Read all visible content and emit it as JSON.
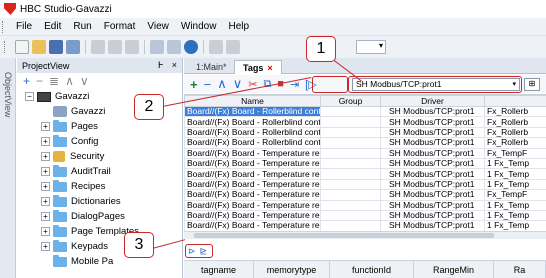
{
  "window": {
    "title": "HBC Studio-Gavazzi"
  },
  "menu": [
    "File",
    "Edit",
    "Run",
    "Format",
    "View",
    "Window",
    "Help"
  ],
  "side_tab": "ObjectView",
  "project_panel": {
    "title": "ProjectView",
    "pin": "Ͱ",
    "close": "×",
    "tree": [
      {
        "label": "Gavazzi",
        "icon": "pc",
        "exp": "−"
      },
      {
        "label": "Gavazzi",
        "icon": "db",
        "exp": ""
      },
      {
        "label": "Pages",
        "icon": "folder",
        "exp": "+"
      },
      {
        "label": "Config",
        "icon": "folder",
        "exp": "+"
      },
      {
        "label": "Security",
        "icon": "lock",
        "exp": "+"
      },
      {
        "label": "AuditTrail",
        "icon": "folder",
        "exp": "+"
      },
      {
        "label": "Recipes",
        "icon": "folder",
        "exp": "+"
      },
      {
        "label": "Dictionaries",
        "icon": "folder",
        "exp": "+"
      },
      {
        "label": "DialogPages",
        "icon": "folder",
        "exp": "+"
      },
      {
        "label": "Page Templates",
        "icon": "folder",
        "exp": "+"
      },
      {
        "label": "Keypads",
        "icon": "folder",
        "exp": "+"
      },
      {
        "label": "Mobile Pa",
        "icon": "folder",
        "exp": ""
      }
    ]
  },
  "tabs": {
    "main": "1:Main*",
    "tags": "Tags",
    "tags_close": "×"
  },
  "driver_selector": {
    "value": "SH Modbus/TCP:prot1",
    "arrow": "▾"
  },
  "grid": {
    "headers": [
      "Name",
      "Group",
      "Driver",
      ""
    ],
    "rows": [
      [
        "Board//(Fx) Board - Rollerblind control.",
        "",
        "SH Modbus/TCP:prot1",
        "Fx_Rollerb"
      ],
      [
        "Board//(Fx) Board - Rollerblind control.",
        "",
        "SH Modbus/TCP:prot1",
        "Fx_Rollerb"
      ],
      [
        "Board//(Fx) Board - Rollerblind control.",
        "",
        "SH Modbus/TCP:prot1",
        "Fx_Rollerb"
      ],
      [
        "Board//(Fx) Board - Rollerblind control.",
        "",
        "SH Modbus/TCP:prot1",
        "Fx_Rollerb"
      ],
      [
        "Board//(Fx) Board - Temperature regul",
        "",
        "SH Modbus/TCP:prot1",
        "Fx_TempF"
      ],
      [
        "Board//(Fx) Board - Temperature regul",
        "",
        "SH Modbus/TCP:prot1",
        "1 Fx_Temp"
      ],
      [
        "Board//(Fx) Board - Temperature regul",
        "",
        "SH Modbus/TCP:prot1",
        "1 Fx_Temp"
      ],
      [
        "Board//(Fx) Board - Temperature regul",
        "",
        "SH Modbus/TCP:prot1",
        "1 Fx_Temp"
      ],
      [
        "Board//(Fx) Board - Temperature regul",
        "",
        "SH Modbus/TCP:prot1",
        "Fx_TempF"
      ],
      [
        "Board//(Fx) Board - Temperature regul",
        "",
        "SH Modbus/TCP:prot1",
        "1 Fx_Temp"
      ],
      [
        "Board//(Fx) Board - Temperature regul",
        "",
        "SH Modbus/TCP:prot1",
        "1 Fx_Temp"
      ],
      [
        "Board//(Fx) Board - Temperature regul",
        "",
        "SH Modbus/TCP:prot1",
        "1 Fx_Temp"
      ]
    ]
  },
  "sub_grid": {
    "headers": [
      "tagname",
      "memorytype",
      "functionId",
      "RangeMin",
      "Ra"
    ]
  },
  "callouts": [
    "1",
    "2",
    "3"
  ],
  "colors": {
    "callout": "#c8282a",
    "selection": "#3d7fd6"
  }
}
